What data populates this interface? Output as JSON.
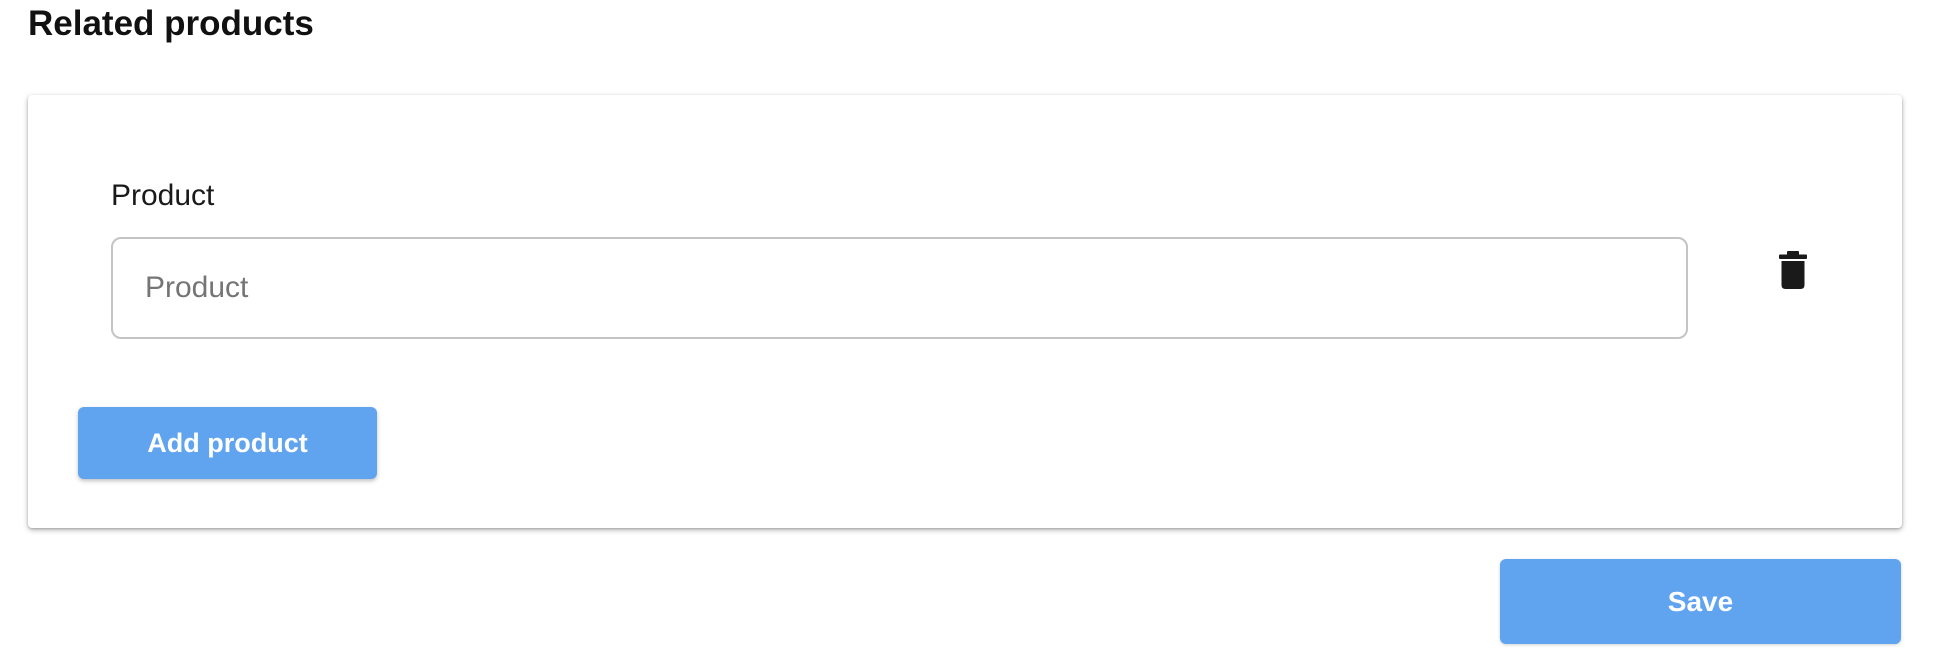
{
  "section": {
    "title": "Related products"
  },
  "product_row": {
    "label": "Product",
    "value": "",
    "placeholder": "Product",
    "delete_icon": "trash-icon"
  },
  "actions": {
    "add_label": "Add product",
    "save_label": "Save"
  },
  "colors": {
    "button_bg": "#60a3ef",
    "button_text": "#ffffff",
    "icon": "#1a1a1a",
    "input_border": "#c4c4c4"
  }
}
